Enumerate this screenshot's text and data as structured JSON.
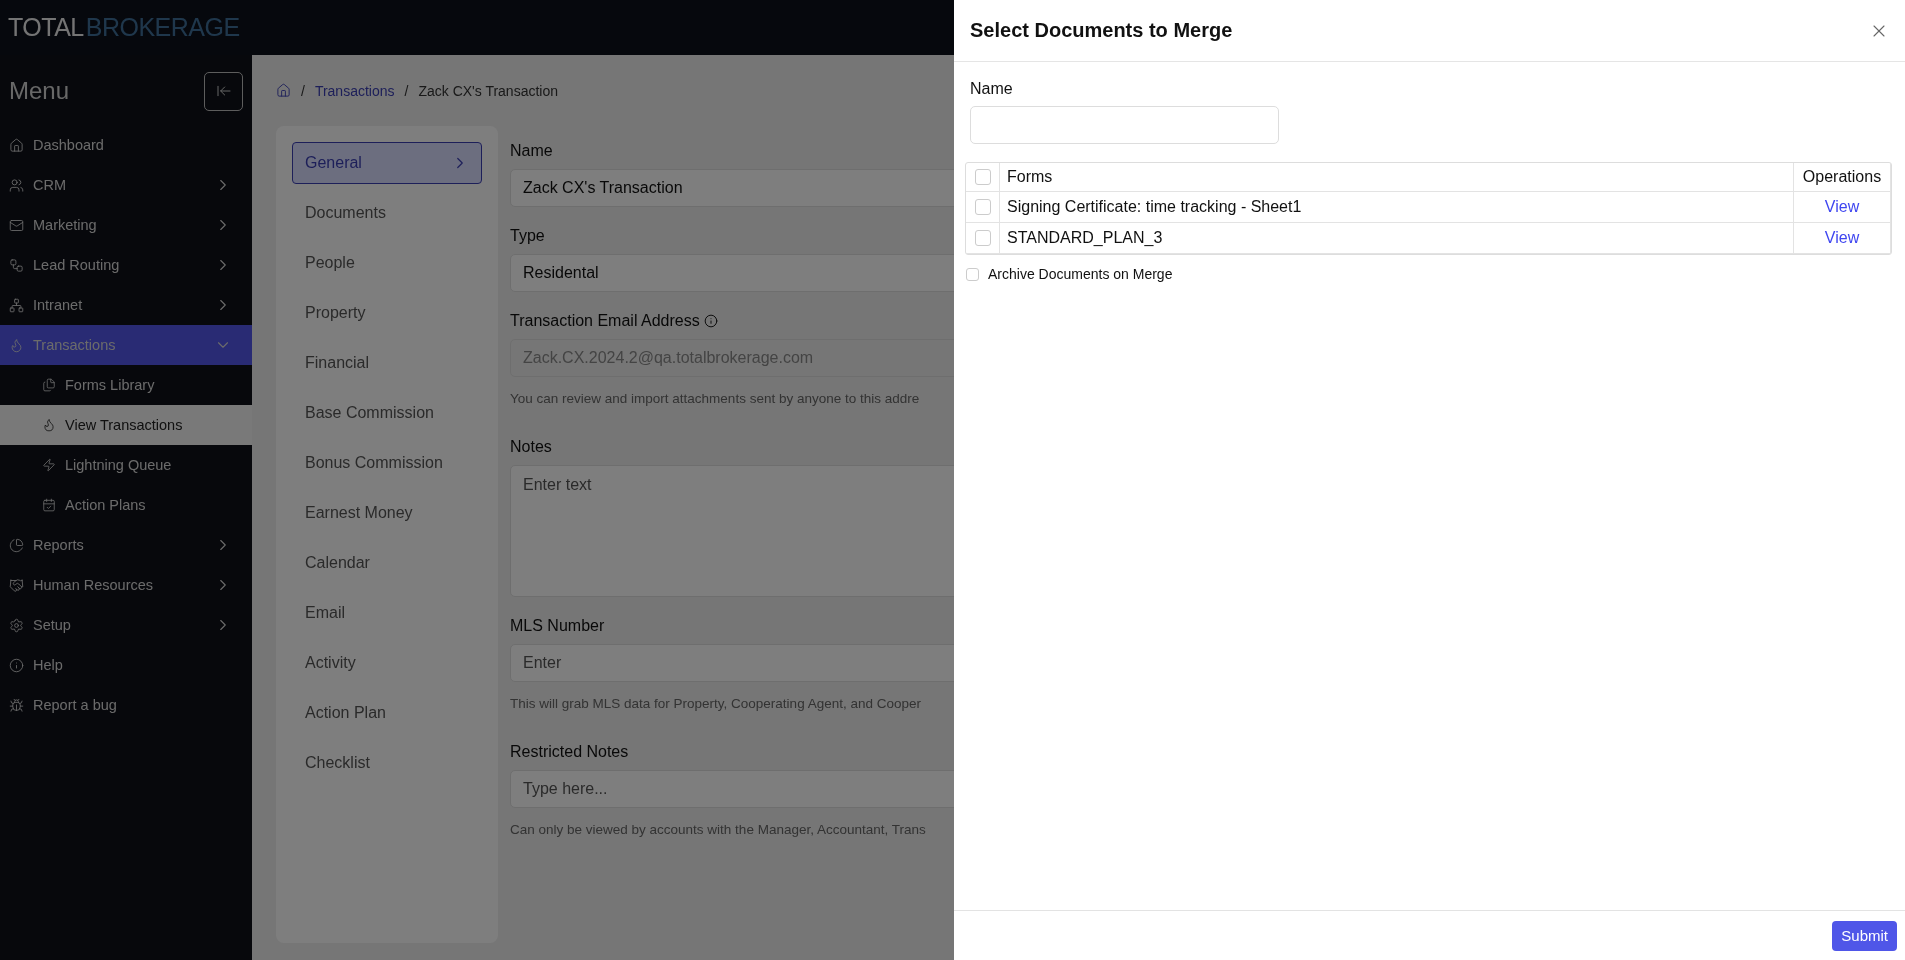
{
  "logo": {
    "words": [
      "TOTAL",
      "BROKERAGE"
    ]
  },
  "sidebar": {
    "title": "Menu",
    "items": [
      {
        "label": "Dashboard",
        "selected": false
      },
      {
        "label": "CRM",
        "expanded": false,
        "selected": false
      },
      {
        "label": "Marketing",
        "expanded": false,
        "selected": false
      },
      {
        "label": "Lead Routing",
        "expanded": false,
        "selected": false
      },
      {
        "label": "Intranet",
        "expanded": false,
        "selected": false
      },
      {
        "label": "Transactions",
        "expanded": true,
        "selected": true,
        "children": [
          {
            "label": "Forms Library",
            "selected": false
          },
          {
            "label": "View Transactions",
            "selected": true
          },
          {
            "label": "Lightning Queue",
            "selected": false
          },
          {
            "label": "Action Plans",
            "selected": false
          }
        ]
      },
      {
        "label": "Reports",
        "expanded": false,
        "selected": false
      },
      {
        "label": "Human Resources",
        "expanded": false,
        "selected": false
      },
      {
        "label": "Setup",
        "expanded": false,
        "selected": false
      },
      {
        "label": "Help",
        "selected": false
      },
      {
        "label": "Report a bug",
        "selected": false
      }
    ]
  },
  "breadcrumb": {
    "separator": "/",
    "items": [
      "Transactions",
      "Zack CX's Transaction"
    ]
  },
  "tabs": [
    {
      "label": "General",
      "selected": true
    },
    {
      "label": "Documents",
      "selected": false
    },
    {
      "label": "People",
      "selected": false
    },
    {
      "label": "Property",
      "selected": false
    },
    {
      "label": "Financial",
      "selected": false
    },
    {
      "label": "Base Commission",
      "selected": false
    },
    {
      "label": "Bonus Commission",
      "selected": false
    },
    {
      "label": "Earnest Money",
      "selected": false
    },
    {
      "label": "Calendar",
      "selected": false
    },
    {
      "label": "Email",
      "selected": false
    },
    {
      "label": "Activity",
      "selected": false
    },
    {
      "label": "Action Plan",
      "selected": false
    },
    {
      "label": "Checklist",
      "selected": false
    }
  ],
  "fields": [
    {
      "kind": "input",
      "label": "Name",
      "value": "Zack CX's Transaction",
      "disabled": false
    },
    {
      "kind": "input",
      "label": "Type",
      "value": "Residental",
      "disabled": false
    },
    {
      "kind": "input",
      "label": "Transaction Email Address",
      "value": "Zack.CX.2024.2@qa.totalbrokerage.com",
      "disabled": true,
      "info": true,
      "hint": "You can review and import attachments sent by anyone to this addre"
    },
    {
      "kind": "textarea",
      "label": "Notes",
      "placeholder": "Enter text"
    },
    {
      "kind": "input",
      "label": "MLS Number",
      "placeholder": "Enter",
      "hint": "This will grab MLS data for Property, Cooperating Agent, and Cooper"
    },
    {
      "kind": "input",
      "label": "Restricted Notes",
      "placeholder": "Type here...",
      "hint": "Can only be viewed by accounts with the Manager, Accountant, Trans"
    }
  ],
  "drawer": {
    "title": "Select Documents to Merge",
    "name_field": {
      "label": "Name"
    },
    "table": {
      "columns": [
        "Forms",
        "Operations"
      ],
      "all_checked": false,
      "rows": [
        {
          "form": "Signing Certificate: time tracking - Sheet1",
          "action": "View",
          "checked": false
        },
        {
          "form": "STANDARD_PLAN_3",
          "action": "View",
          "checked": false
        }
      ]
    },
    "archive": {
      "label": "Archive Documents on Merge",
      "checked": false
    },
    "submit": "Submit"
  }
}
